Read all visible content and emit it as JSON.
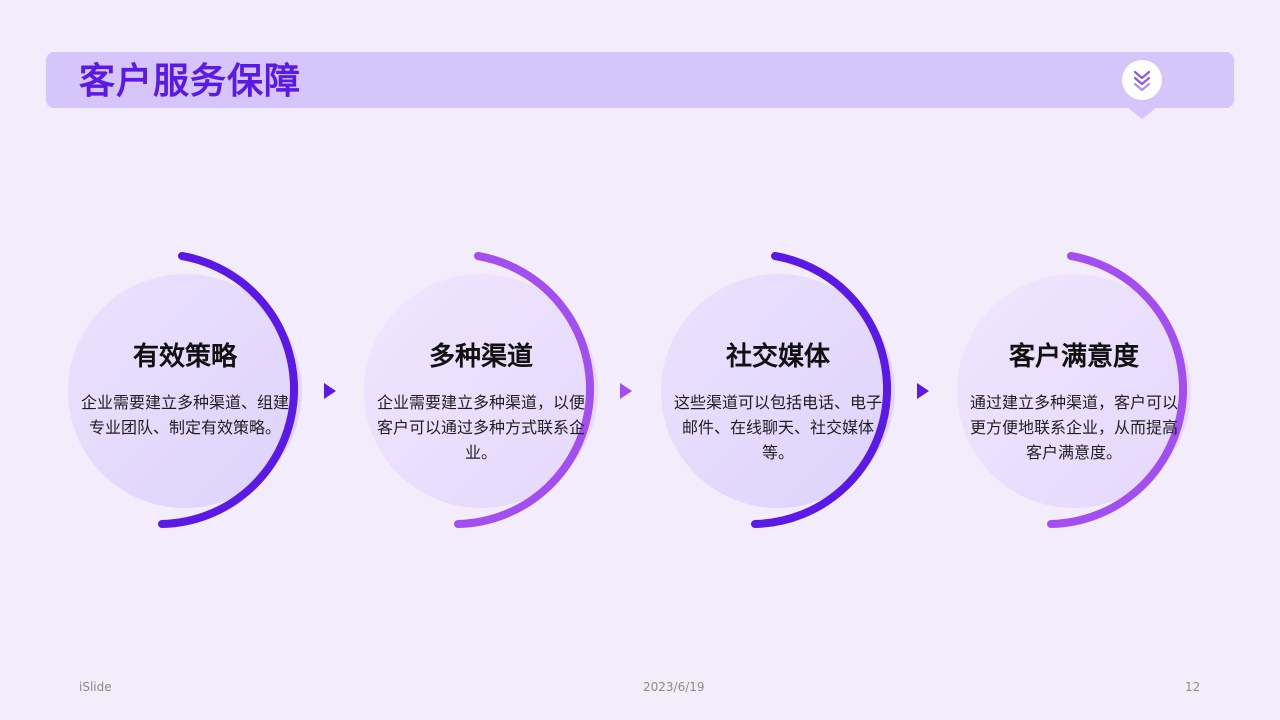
{
  "header": {
    "title": "客户服务保障",
    "badge_icon": "double-chevron-down-icon"
  },
  "cards": [
    {
      "title": "有效策略",
      "desc": "企业需要建立多种渠道、组建专业团队、制定有效策略。"
    },
    {
      "title": "多种渠道",
      "desc": "企业需要建立多种渠道，以便客户可以通过多种方式联系企业。"
    },
    {
      "title": "社交媒体",
      "desc": "这些渠道可以包括电话、电子邮件、在线聊天、社交媒体等。"
    },
    {
      "title": "客户满意度",
      "desc": "通过建立多种渠道，客户可以更方便地联系企业，从而提高客户满意度。"
    }
  ],
  "footer": {
    "left": "iSlide",
    "center": "2023/6/19",
    "right": "12"
  },
  "colors": {
    "accent": "#5a19e6",
    "accent_light": "#a24ef0",
    "header_bg": "#d6c5fa",
    "page_bg": "#f2ecfb"
  }
}
